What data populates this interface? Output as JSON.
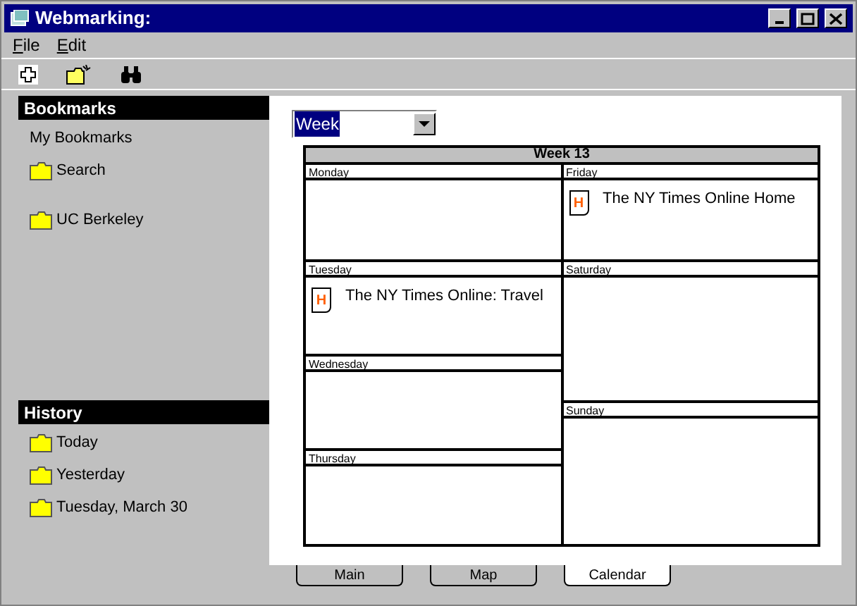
{
  "window": {
    "title": "Webmarking:"
  },
  "menu": [
    {
      "label": "File"
    },
    {
      "label": "Edit"
    }
  ],
  "sidebar": {
    "sections": [
      {
        "title": "Bookmarks",
        "items": [
          {
            "kind": "text",
            "label": "My Bookmarks"
          },
          {
            "kind": "folder",
            "label": "Search"
          },
          {
            "kind": "folder",
            "label": "UC Berkeley"
          }
        ]
      },
      {
        "title": "History",
        "items": [
          {
            "kind": "folder",
            "label": "Today"
          },
          {
            "kind": "folder",
            "label": "Yesterday"
          },
          {
            "kind": "folder",
            "label": "Tuesday, March 30"
          }
        ]
      }
    ]
  },
  "view_select": {
    "value": "Week"
  },
  "calendar": {
    "title": "Week 13",
    "columns": [
      [
        {
          "day": "Monday"
        },
        {
          "day": "Tuesday",
          "entries": [
            {
              "badge": "H",
              "title": "The NY Times Online: Travel"
            }
          ]
        },
        {
          "day": "Wednesday"
        },
        {
          "day": "Thursday"
        }
      ],
      [
        {
          "day": "Friday",
          "entries": [
            {
              "badge": "H",
              "title": "The NY Times Online Home"
            }
          ]
        },
        {
          "day": "Saturday"
        },
        {
          "day": "Sunday"
        }
      ]
    ]
  },
  "tabs": [
    {
      "label": "Main",
      "selected": false
    },
    {
      "label": "Map",
      "selected": false
    },
    {
      "label": "Calendar",
      "selected": true
    }
  ]
}
